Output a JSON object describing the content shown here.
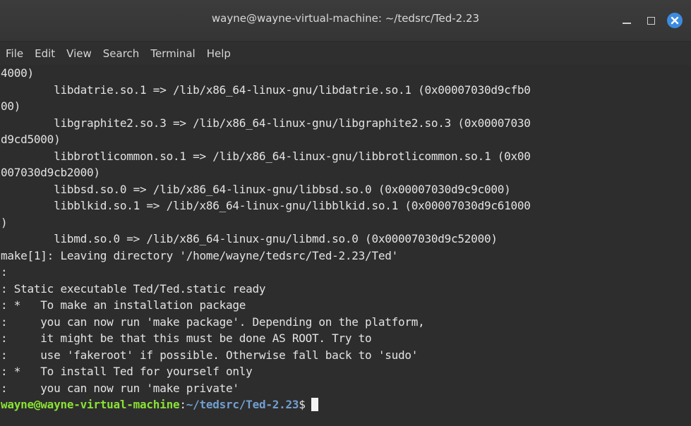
{
  "window": {
    "title": "wayne@wayne-virtual-machine: ~/tedsrc/Ted-2.23",
    "accent_color": "#3d8be0"
  },
  "menu": {
    "items": [
      "File",
      "Edit",
      "View",
      "Search",
      "Terminal",
      "Help"
    ]
  },
  "terminal": {
    "lines": [
      "4000)",
      "        libdatrie.so.1 => /lib/x86_64-linux-gnu/libdatrie.so.1 (0x00007030d9cfb0",
      "00)",
      "        libgraphite2.so.3 => /lib/x86_64-linux-gnu/libgraphite2.so.3 (0x00007030",
      "d9cd5000)",
      "        libbrotlicommon.so.1 => /lib/x86_64-linux-gnu/libbrotlicommon.so.1 (0x00",
      "007030d9cb2000)",
      "        libbsd.so.0 => /lib/x86_64-linux-gnu/libbsd.so.0 (0x00007030d9c9c000)",
      "        libblkid.so.1 => /lib/x86_64-linux-gnu/libblkid.so.1 (0x00007030d9c61000",
      ")",
      "        libmd.so.0 => /lib/x86_64-linux-gnu/libmd.so.0 (0x00007030d9c52000)",
      "make[1]: Leaving directory '/home/wayne/tedsrc/Ted-2.23/Ted'",
      ":",
      ": Static executable Ted/Ted.static ready",
      ": *   To make an installation package",
      ":     you can now run 'make package'. Depending on the platform,",
      ":     it might be that this must be done AS ROOT. Try to",
      ":     use 'fakeroot' if possible. Otherwise fall back to 'sudo'",
      ": *   To install Ted for yourself only",
      ":     you can now run 'make private'"
    ],
    "prompt": {
      "user_host": "wayne@wayne-virtual-machine",
      "separator": ":",
      "path": "~/tedsrc/Ted-2.23",
      "symbol": "$"
    },
    "colors": {
      "background": "#2d2d2d",
      "text": "#e3e3e3",
      "prompt_user": "#8ae234",
      "prompt_path": "#729fcf"
    }
  }
}
